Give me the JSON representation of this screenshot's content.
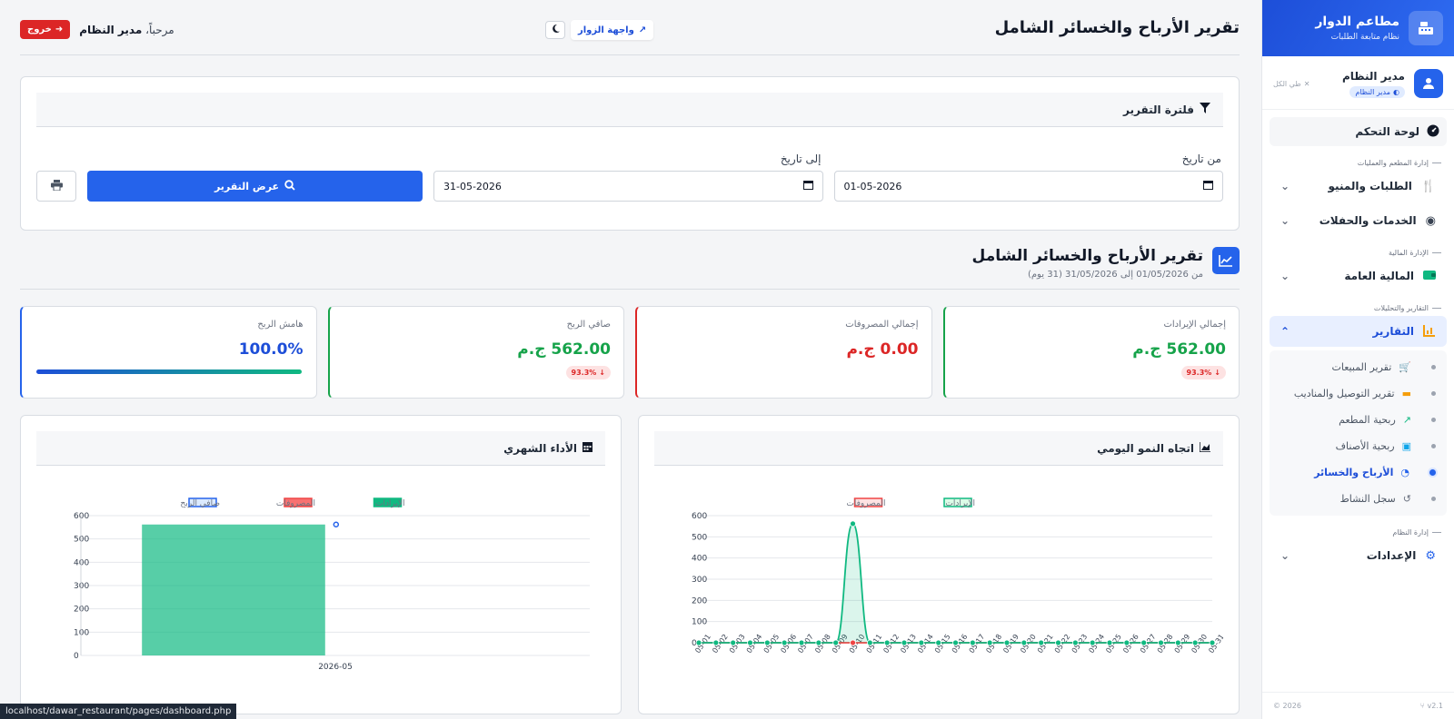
{
  "brand": {
    "title": "مطاعم الدوار",
    "subtitle": "نظام متابعة الطلبات"
  },
  "user": {
    "name": "مدير النظام",
    "role": "مدير النظام",
    "collapse_all": "طي الكل"
  },
  "nav": {
    "dashboard": "لوحة التحكم",
    "sections": {
      "ops": "إدارة المطعم والعمليات",
      "finance": "الإدارة المالية",
      "reports": "التقارير والتحليلات",
      "system": "إدارة النظام"
    },
    "orders_menu": "الطلبات والمنيو",
    "services": "الخدمات والحفلات",
    "general_finance": "المالية العامة",
    "reports": "التقارير",
    "settings": "الإعدادات",
    "report_items": [
      "تقرير المبيعات",
      "تقرير التوصيل والمناديب",
      "ربحية المطعم",
      "ربحية الأصناف",
      "الأرباح والخسائر",
      "سجل النشاط"
    ]
  },
  "footer": {
    "version": "v2.1",
    "year": "2026 ©"
  },
  "header": {
    "title": "تقرير الأرباح والخسائر الشامل",
    "visitor_link": "واجهة الزوار",
    "welcome_prefix": "مرحباً،",
    "welcome_name": "مدير النظام",
    "logout": "خروج"
  },
  "filter": {
    "title": "فلترة التقرير",
    "from_label": "من تاريخ",
    "from_value": "01-05-2026",
    "to_label": "إلى تاريخ",
    "to_value": "31-05-2026",
    "show_button": "عرض التقرير"
  },
  "report": {
    "title": "تقرير الأرباح والخسائر الشامل",
    "subtitle": "من 01/05/2026 إلى 31/05/2026 (31 يوم)"
  },
  "cards": {
    "revenue": {
      "label": "إجمالي الإيرادات",
      "value": "562.00 ج.م",
      "trend": "93.3%"
    },
    "expenses": {
      "label": "إجمالي المصروفات",
      "value": "0.00 ج.م"
    },
    "net_profit": {
      "label": "صافي الربح",
      "value": "562.00 ج.م",
      "trend": "93.3%"
    },
    "margin": {
      "label": "هامش الربح",
      "value": "100.0%",
      "fill": 1.0
    }
  },
  "colors": {
    "primary": "#2563eb",
    "success": "#16a34a",
    "danger": "#dc2626"
  },
  "chart_data": [
    {
      "type": "line",
      "title": "اتجاه النمو اليومي",
      "x": [
        "05-01",
        "05-02",
        "05-03",
        "05-04",
        "05-05",
        "05-06",
        "05-07",
        "05-08",
        "05-09",
        "05-10",
        "05-11",
        "05-12",
        "05-13",
        "05-14",
        "05-15",
        "05-16",
        "05-17",
        "05-18",
        "05-19",
        "05-20",
        "05-21",
        "05-22",
        "05-23",
        "05-24",
        "05-25",
        "05-26",
        "05-27",
        "05-28",
        "05-29",
        "05-30",
        "05-31"
      ],
      "series": [
        {
          "name": "الإيرادات",
          "color": "#10b981",
          "values": [
            0,
            0,
            0,
            0,
            0,
            0,
            0,
            0,
            0,
            562,
            0,
            0,
            0,
            0,
            0,
            0,
            0,
            0,
            0,
            0,
            0,
            0,
            0,
            0,
            0,
            0,
            0,
            0,
            0,
            0,
            0
          ]
        },
        {
          "name": "المصروفات",
          "color": "#ef4444",
          "values": [
            0,
            0,
            0,
            0,
            0,
            0,
            0,
            0,
            0,
            0,
            0,
            0,
            0,
            0,
            0,
            0,
            0,
            0,
            0,
            0,
            0,
            0,
            0,
            0,
            0,
            0,
            0,
            0,
            0,
            0,
            0
          ]
        }
      ],
      "legend": "top",
      "ylim": [
        0,
        600
      ],
      "yticks": [
        0,
        100,
        200,
        300,
        400,
        500,
        600
      ],
      "grid": true
    },
    {
      "type": "bar",
      "title": "الأداء الشهري",
      "categories": [
        "2026-05"
      ],
      "series": [
        {
          "name": "الإيرادات",
          "color": "#10b981",
          "values": [
            562
          ]
        },
        {
          "name": "المصروفات",
          "color": "#ef4444",
          "values": [
            0
          ]
        },
        {
          "name": "صافي الربح",
          "color": "#2563eb",
          "values": [
            562
          ]
        }
      ],
      "legend": "top",
      "ylim": [
        0,
        600
      ],
      "yticks": [
        0,
        100,
        200,
        300,
        400,
        500,
        600
      ],
      "grid": true
    }
  ],
  "status_url": "localhost/dawar_restaurant/pages/dashboard.php"
}
